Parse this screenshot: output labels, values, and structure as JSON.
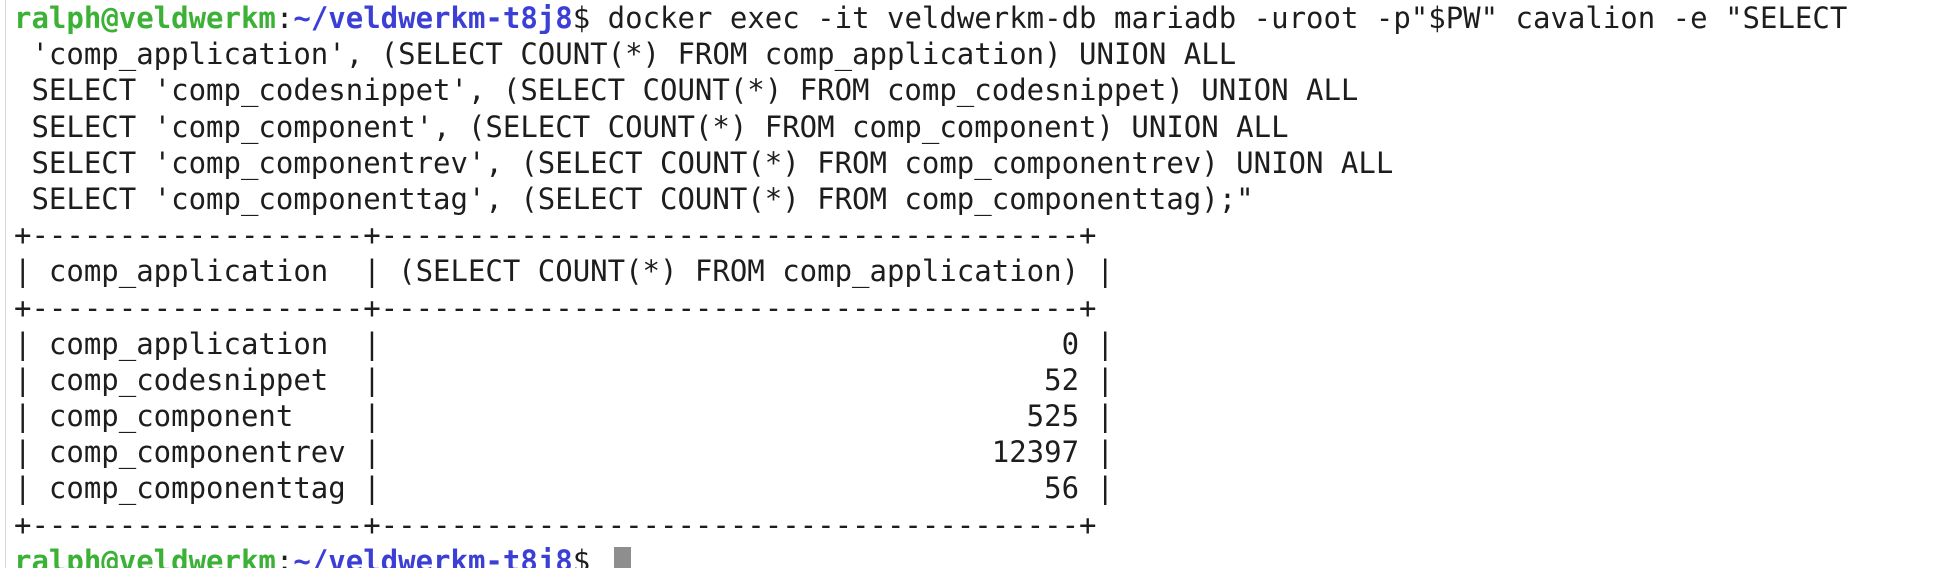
{
  "prompt": {
    "user_host": "ralph@veldwerkm",
    "separator": ":",
    "path": "~/veldwerkm-t8j8",
    "symbol": "$ "
  },
  "command_lines": [
    "docker exec -it veldwerkm-db mariadb -uroot -p\"$PW\" cavalion -e \"SELECT",
    " 'comp_application', (SELECT COUNT(*) FROM comp_application) UNION ALL",
    " SELECT 'comp_codesnippet', (SELECT COUNT(*) FROM comp_codesnippet) UNION ALL",
    " SELECT 'comp_component', (SELECT COUNT(*) FROM comp_component) UNION ALL",
    " SELECT 'comp_componentrev', (SELECT COUNT(*) FROM comp_componentrev) UNION ALL",
    " SELECT 'comp_componenttag', (SELECT COUNT(*) FROM comp_componenttag);\""
  ],
  "output_lines": [
    "+-------------------+----------------------------------------+",
    "| comp_application  | (SELECT COUNT(*) FROM comp_application) |",
    "+-------------------+----------------------------------------+",
    "| comp_application  |                                       0 |",
    "| comp_codesnippet  |                                      52 |",
    "| comp_component    |                                     525 |",
    "| comp_componentrev |                                   12397 |",
    "| comp_componenttag |                                      56 |",
    "+-------------------+----------------------------------------+"
  ],
  "result_table": {
    "header": [
      "comp_application",
      "(SELECT COUNT(*) FROM comp_application)"
    ],
    "rows": [
      [
        "comp_application",
        "0"
      ],
      [
        "comp_codesnippet",
        "52"
      ],
      [
        "comp_component",
        "525"
      ],
      [
        "comp_componentrev",
        "12397"
      ],
      [
        "comp_componenttag",
        "56"
      ]
    ]
  },
  "colors": {
    "background": "#ffffff",
    "text": "#1d1d1d",
    "prompt_user": "#3bb136",
    "prompt_path": "#3b3fd6",
    "cursor": "#8e8e8e"
  }
}
